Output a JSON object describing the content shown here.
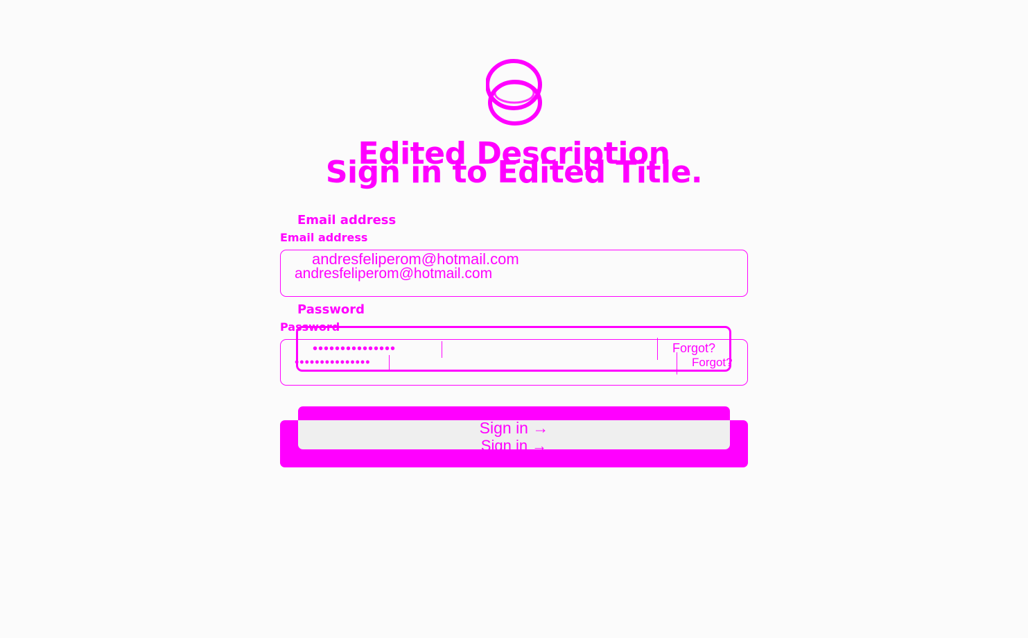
{
  "page": {
    "title": "Sign in to Edited Title.",
    "description": "Edited Description"
  },
  "icons": {
    "logo": "interlocking-rings-logo"
  },
  "colors": {
    "accent": "#ff00ff",
    "background": "#fbfbfb",
    "button_inner": "#efefef"
  },
  "email": {
    "label": "Email address",
    "value": "andresfeliperom@hotmail.com"
  },
  "password": {
    "label": "Password",
    "value_masked": "•••••••••••••••",
    "value_masked_alt": "•••••••••••••••",
    "forgot_label": "Forgot?"
  },
  "submit": {
    "label": "Sign in →"
  }
}
